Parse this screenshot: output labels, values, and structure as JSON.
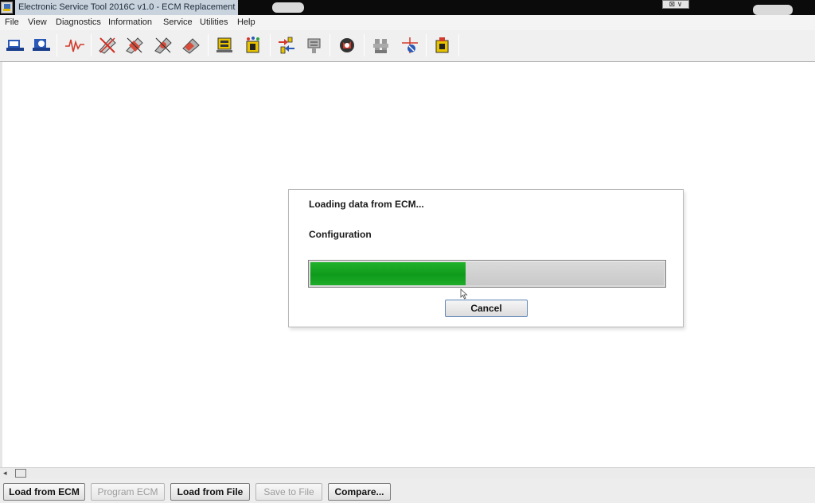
{
  "window": {
    "title": "Electronic Service Tool 2016C v1.0 - ECM Replacement",
    "controls": "⊠ ∨"
  },
  "menu": [
    "File",
    "View",
    "Diagnostics",
    "Information",
    "Service",
    "Utilities",
    "Help"
  ],
  "toolbar": {
    "icons": [
      "connect-icon",
      "ecm-summary-icon",
      "status-waveform-icon",
      "active-diagnostics-icon",
      "logged-diagnostics-icon",
      "events-icon",
      "clear-codes-icon",
      "configuration-icon",
      "calibrations-icon",
      "data-transfer-icon",
      "flash-icon",
      "ecm-replacement-icon",
      "settings-icon",
      "service-program-icon",
      "module-icon"
    ]
  },
  "dialog": {
    "message": "Loading data from ECM...",
    "stage": "Configuration",
    "progress": 0.44,
    "cancel_label": "Cancel"
  },
  "scrollbar": {
    "left_arrow": "◂"
  },
  "bottom_buttons": [
    {
      "label": "Load from ECM",
      "enabled": true
    },
    {
      "label": "Program ECM",
      "enabled": false
    },
    {
      "label": "Load from File",
      "enabled": true
    },
    {
      "label": "Save to File",
      "enabled": false
    },
    {
      "label": "Compare...",
      "enabled": true
    }
  ],
  "colors": {
    "progress_fill": "#139e1f",
    "dialog_button_border": "#5e86b7",
    "title_bar": "#0b0b0b"
  }
}
